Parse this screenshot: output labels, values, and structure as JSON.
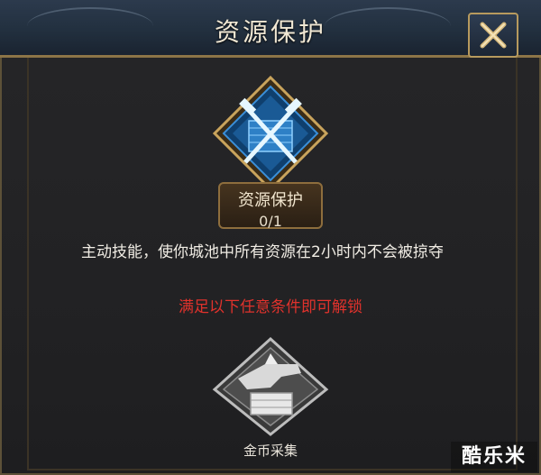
{
  "header": {
    "title": "资源保护",
    "close_icon": "close-x-icon"
  },
  "skill": {
    "icon": "crossed-hammers-shield-icon",
    "name": "资源保护",
    "level": "0/1",
    "description": "主动技能，使你城池中所有资源在2小时内不会被掠夺"
  },
  "unlock": {
    "hint": "满足以下任意条件即可解锁",
    "hint_color": "#e0322c",
    "conditions": [
      {
        "icon": "gold-collect-icon",
        "label": "金币采集"
      }
    ]
  },
  "watermark": {
    "text": "酷乐米"
  },
  "colors": {
    "accent_gold": "#b79a5e",
    "skill_blue": "#2b7bc0"
  }
}
